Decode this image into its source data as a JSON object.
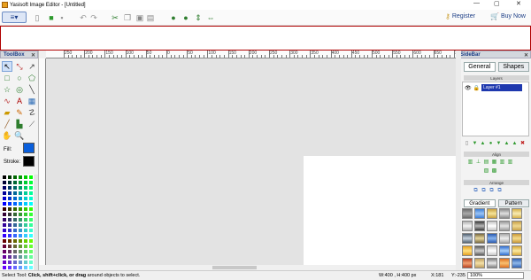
{
  "window": {
    "title": "Yasisoft Image Editor - [Untitled]",
    "controls": [
      "—",
      "▢",
      "✕"
    ]
  },
  "toolbar": {
    "menu_icon": "≡▾",
    "buttons": [
      {
        "name": "new-icon",
        "glyph": "▯",
        "color": "#888888"
      },
      {
        "name": "open-icon",
        "glyph": "■",
        "color": "#2e9a2e"
      },
      {
        "name": "save-icon",
        "glyph": "▪",
        "color": "#999999"
      },
      {
        "name": "undo-icon",
        "glyph": "↶",
        "color": "#999999"
      },
      {
        "name": "redo-icon",
        "glyph": "↷",
        "color": "#999999"
      },
      {
        "name": "cut-icon",
        "glyph": "✂",
        "color": "#2e7d2e"
      },
      {
        "name": "copy-icon",
        "glyph": "❐",
        "color": "#888888"
      },
      {
        "name": "paste-icon",
        "glyph": "▣",
        "color": "#888888"
      },
      {
        "name": "delete-icon",
        "glyph": "▤",
        "color": "#888888"
      },
      {
        "name": "group-icon",
        "glyph": "●",
        "color": "#2e7d2e"
      },
      {
        "name": "ungroup-icon",
        "glyph": "●",
        "color": "#2e7d2e"
      },
      {
        "name": "flip-vertical-icon",
        "glyph": "⇕",
        "color": "#2e7d2e"
      },
      {
        "name": "flip-horizontal-icon",
        "glyph": "⇔",
        "color": "#2e7d2e"
      }
    ],
    "register_label": "Register",
    "buy_label": "Buy Now"
  },
  "toolbox": {
    "title": "ToolBox",
    "tools": [
      {
        "name": "select-tool-icon",
        "glyph": "↖",
        "color": "#000000",
        "selected": true
      },
      {
        "name": "transform-tool-icon",
        "glyph": "⤡",
        "color": "#b33"
      },
      {
        "name": "direct-select-tool-icon",
        "glyph": "↗",
        "color": "#444"
      },
      {
        "name": "rectangle-tool-icon",
        "glyph": "□",
        "color": "#2e7d2e"
      },
      {
        "name": "ellipse-tool-icon",
        "glyph": "○",
        "color": "#2e7d2e"
      },
      {
        "name": "polygon-tool-icon",
        "glyph": "⬠",
        "color": "#2e7d2e"
      },
      {
        "name": "star-tool-icon",
        "glyph": "☆",
        "color": "#2e7d2e"
      },
      {
        "name": "spiral-tool-icon",
        "glyph": "◎",
        "color": "#2e7d2e"
      },
      {
        "name": "line-tool-icon",
        "glyph": "╲",
        "color": "#333"
      },
      {
        "name": "bezier-tool-icon",
        "glyph": "∿",
        "color": "#b33"
      },
      {
        "name": "text-tool-icon",
        "glyph": "A",
        "color": "#a00"
      },
      {
        "name": "image-tool-icon",
        "glyph": "▦",
        "color": "#2a6ab5"
      },
      {
        "name": "eraser-tool-icon",
        "glyph": "▰",
        "color": "#c90"
      },
      {
        "name": "pencil-tool-icon",
        "glyph": "✎",
        "color": "#c60"
      },
      {
        "name": "path-tool-icon",
        "glyph": "☡",
        "color": "#444"
      },
      {
        "name": "brush-tool-icon",
        "glyph": "╱",
        "color": "#963"
      },
      {
        "name": "fill-tool-icon",
        "glyph": "▙",
        "color": "#2e7d2e"
      },
      {
        "name": "eyedropper-tool-icon",
        "glyph": "⟋",
        "color": "#555"
      },
      {
        "name": "pan-tool-icon",
        "glyph": "✋",
        "color": "#2e9a2e"
      },
      {
        "name": "zoom-tool-icon",
        "glyph": "🔍",
        "color": "#2a6ab5"
      }
    ],
    "fill_label": "Fill:",
    "fill_color": "#0a5fdc",
    "stroke_label": "Stroke:",
    "stroke_color": "#000000",
    "palette": [
      "#000000",
      "#003300",
      "#006600",
      "#009900",
      "#00cc00",
      "#00ff00",
      "#000033",
      "#003333",
      "#006633",
      "#009933",
      "#00cc33",
      "#00ff33",
      "#000066",
      "#003366",
      "#006666",
      "#009966",
      "#00cc66",
      "#00ff66",
      "#000099",
      "#003399",
      "#006699",
      "#009999",
      "#00cc99",
      "#00ff99",
      "#0000cc",
      "#0033cc",
      "#0066cc",
      "#0099cc",
      "#00cccc",
      "#00ffcc",
      "#0000ff",
      "#0033ff",
      "#0066ff",
      "#0099ff",
      "#00ccff",
      "#00ffff",
      "#330000",
      "#333300",
      "#336600",
      "#339900",
      "#33cc00",
      "#33ff00",
      "#330033",
      "#333333",
      "#336633",
      "#339933",
      "#33cc33",
      "#33ff33",
      "#330066",
      "#333366",
      "#336666",
      "#339966",
      "#33cc66",
      "#33ff66",
      "#330099",
      "#333399",
      "#336699",
      "#339999",
      "#33cc99",
      "#33ff99",
      "#3300cc",
      "#3333cc",
      "#3366cc",
      "#3399cc",
      "#33cccc",
      "#33ffcc",
      "#3300ff",
      "#3333ff",
      "#3366ff",
      "#3399ff",
      "#33ccff",
      "#33ffff",
      "#660000",
      "#663300",
      "#666600",
      "#669900",
      "#66cc00",
      "#66ff00",
      "#660033",
      "#663333",
      "#666633",
      "#669933",
      "#66cc33",
      "#66ff33",
      "#660066",
      "#663366",
      "#666666",
      "#669966",
      "#66cc66",
      "#66ff66",
      "#660099",
      "#663399",
      "#666699",
      "#669999",
      "#66cc99",
      "#66ff99",
      "#6600cc",
      "#6633cc",
      "#6666cc",
      "#6699cc",
      "#66cccc",
      "#66ffcc",
      "#6600ff",
      "#6633ff",
      "#6666ff",
      "#6699ff",
      "#66ccff",
      "#66ffff"
    ]
  },
  "ruler": {
    "labels": [
      "250",
      "200",
      "150",
      "100",
      "50",
      "0",
      "50",
      "100",
      "150",
      "200",
      "250",
      "300",
      "350",
      "400",
      "450",
      "500",
      "550",
      "600",
      "650",
      "700"
    ]
  },
  "sidebar": {
    "title": "SideBar",
    "tabs": [
      "General",
      "Shapes"
    ],
    "layers_header": "Layers",
    "layer_name": "Layer #1",
    "layer_actions": [
      "▯",
      "▼",
      "▲",
      "●",
      "▼",
      "▲",
      "▲",
      "✖"
    ],
    "align_header": "Align",
    "align_row1": [
      "▥",
      "⊥",
      "▤",
      "▦",
      "▥",
      "▥"
    ],
    "align_row2": [
      "▧",
      "▩"
    ],
    "arrange_header": "Arrange",
    "arrange_icons": [
      "⧉",
      "⧉",
      "⧉",
      "⧉"
    ],
    "gradient_tab": "Gradient",
    "pattern_tab": "Pattern",
    "gradients": [
      [
        "#6b6b6b",
        "#aaaaaa"
      ],
      [
        "#3c7ed6",
        "#9cc4f5"
      ],
      [
        "#c8a040",
        "#f6e59a"
      ],
      [
        "#8a8a8a",
        "#e0e0e0"
      ],
      [
        "#d6b04a",
        "#f8ecb5"
      ],
      [
        "#b0b0b0",
        "#f5f5f5"
      ],
      [
        "#3a3a3a",
        "#b8b8b8"
      ],
      [
        "#c4c4c4",
        "#ffffff"
      ],
      [
        "#9a9a9a",
        "#e5e5e5"
      ],
      [
        "#c9a24a",
        "#f0d890"
      ],
      [
        "#506070",
        "#c8d4e0"
      ],
      [
        "#7a6a40",
        "#e8d8a0"
      ],
      [
        "#2a5ab0",
        "#88b4ee"
      ],
      [
        "#a8a8a8",
        "#f0f0f0"
      ],
      [
        "#c89838",
        "#f6dc8c"
      ],
      [
        "#e6a020",
        "#ffe080"
      ],
      [
        "#5a5a5a",
        "#d0d0d0"
      ],
      [
        "#c8c8c8",
        "#ffffff"
      ],
      [
        "#2e6cd0",
        "#a8cff8"
      ],
      [
        "#d8a838",
        "#fae8a0"
      ],
      [
        "#b84020",
        "#f0a070"
      ],
      [
        "#c0a060",
        "#f4e0a8"
      ],
      [
        "#808080",
        "#e8e8e8"
      ],
      [
        "#e07020",
        "#f8c070"
      ],
      [
        "#3060b0",
        "#90b8ea"
      ],
      [
        "#a0a0a0",
        "#f0f0f0"
      ],
      [
        "#c0c0c0",
        "#ffffff"
      ],
      [
        "#d09030",
        "#f8e0a0"
      ],
      [
        "#b0b0b0",
        "#e8e8e8"
      ],
      [
        "#c8a040",
        "#f4e4a0"
      ]
    ]
  },
  "status": {
    "prefix": "Select Tool: ",
    "bold_text": "Click, shift+click, or drag",
    "suffix": " around objects to select.",
    "size": "W:400 , H:400 px",
    "x": "X:181",
    "y": "Y:-235",
    "zoom": "100%"
  }
}
